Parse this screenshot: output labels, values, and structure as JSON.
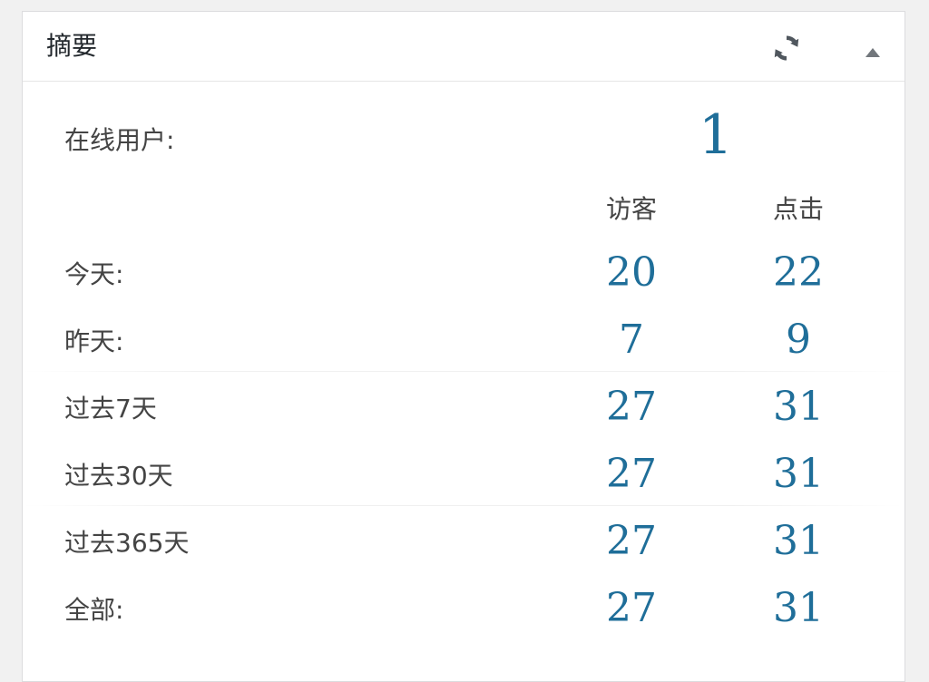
{
  "widget": {
    "title": "摘要",
    "refresh_icon": "refresh-icon",
    "toggle_icon": "triangle-up-icon"
  },
  "online": {
    "label": "在线用户:",
    "value": "1"
  },
  "columns": {
    "visitors": "访客",
    "clicks": "点击"
  },
  "rows": [
    {
      "label": "今天:",
      "visitors": "20",
      "clicks": "22"
    },
    {
      "label": "昨天:",
      "visitors": "7",
      "clicks": "9"
    },
    {
      "label": "过去7天",
      "visitors": "27",
      "clicks": "31"
    },
    {
      "label": "过去30天",
      "visitors": "27",
      "clicks": "31"
    },
    {
      "label": "过去365天",
      "visitors": "27",
      "clicks": "31"
    },
    {
      "label": "全部:",
      "visitors": "27",
      "clicks": "31"
    }
  ],
  "colors": {
    "accent": "#1f6e99",
    "text": "#444444",
    "border": "#dcdcde",
    "background": "#f1f1f1"
  }
}
